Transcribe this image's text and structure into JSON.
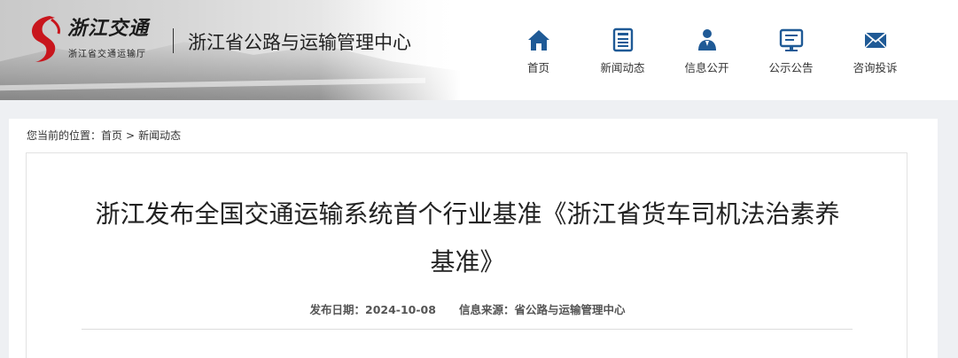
{
  "header": {
    "logo_calligraphy": "浙江交通",
    "logo_subtitle": "浙江省交通运输厅",
    "site_name": "浙江省公路与运输管理中心",
    "brand_color": "#1f5a96",
    "logo_red": "#c8161d"
  },
  "nav": {
    "items": [
      {
        "label": "首页",
        "icon": "home-icon"
      },
      {
        "label": "新闻动态",
        "icon": "news-icon"
      },
      {
        "label": "信息公开",
        "icon": "person-icon"
      },
      {
        "label": "公示公告",
        "icon": "notice-board-icon"
      },
      {
        "label": "咨询投诉",
        "icon": "mail-icon"
      }
    ]
  },
  "breadcrumb": {
    "prefix": "您当前的位置：",
    "items": [
      "首页",
      "新闻动态"
    ],
    "separator": ">"
  },
  "article": {
    "title": "浙江发布全国交通运输系统首个行业基准《浙江省货车司机法治素养基准》",
    "date_label": "发布日期：",
    "date": "2024-10-08",
    "source_label": "信息来源：",
    "source": "省公路与运输管理中心"
  }
}
